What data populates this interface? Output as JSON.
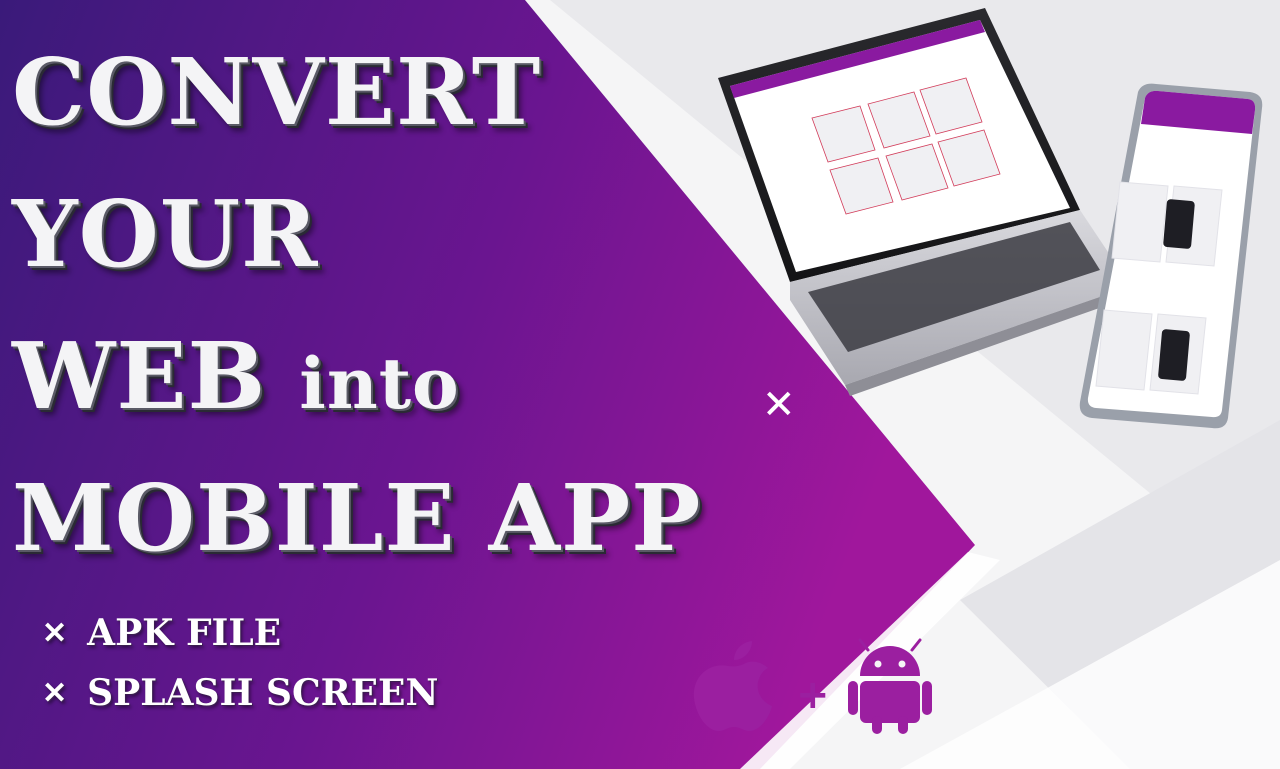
{
  "headline": {
    "line1": "CONVERT",
    "line2": "YOUR",
    "line3_main": "WEB",
    "line3_small": "into",
    "line4": "MOBILE APP"
  },
  "features": [
    {
      "label": "APK FILE",
      "icon": "sparkle-icon"
    },
    {
      "label": "SPLASH SCREEN",
      "icon": "sparkle-icon"
    }
  ],
  "platforms": {
    "separator": "+",
    "icons": [
      "apple-icon",
      "android-icon"
    ]
  },
  "colors": {
    "purple_dark": "#3a1a7a",
    "purple_mid": "#6a1590",
    "magenta": "#a0179c",
    "accent": "#9b1fa0",
    "background_light": "#f2f2f3"
  }
}
